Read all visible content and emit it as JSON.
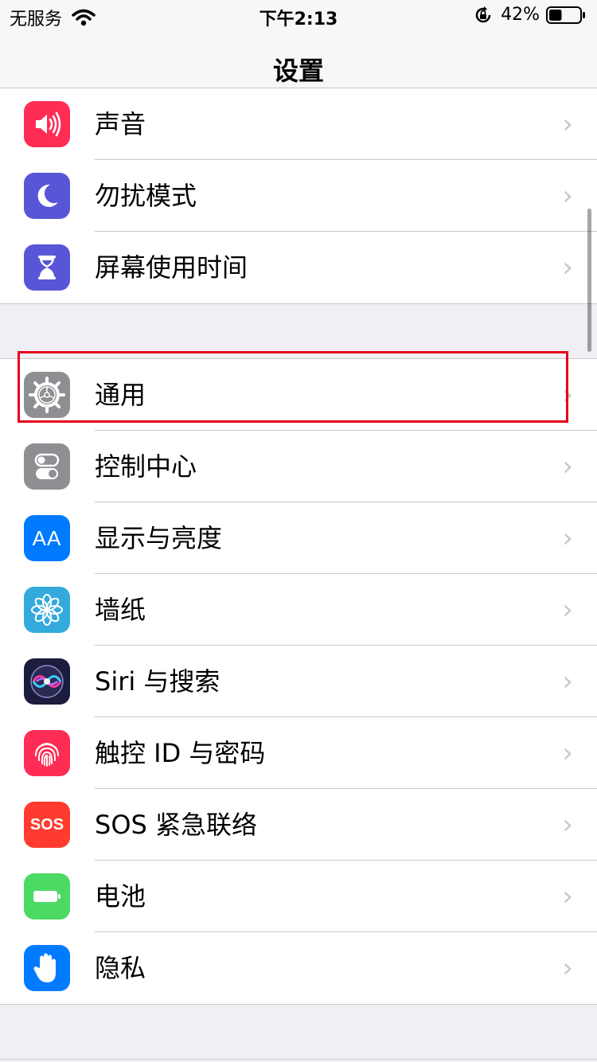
{
  "status_bar": {
    "carrier": "无服务",
    "wifi_icon": "wifi-icon",
    "time": "下午2:13",
    "orientation_lock_icon": "orientation-lock-icon",
    "battery_percent": "42%",
    "battery_level": 0.42
  },
  "nav": {
    "title": "设置"
  },
  "groups": [
    {
      "items": [
        {
          "label": "声音",
          "icon": "speaker-icon",
          "color": "#ff2d55"
        },
        {
          "label": "勿扰模式",
          "icon": "moon-icon",
          "color": "#5856d6"
        },
        {
          "label": "屏幕使用时间",
          "icon": "hourglass-icon",
          "color": "#5856d6"
        }
      ]
    },
    {
      "items": [
        {
          "label": "通用",
          "icon": "gear-icon",
          "color": "#8e8e93"
        },
        {
          "label": "控制中心",
          "icon": "toggles-icon",
          "color": "#8e8e93"
        },
        {
          "label": "显示与亮度",
          "icon": "text-size-icon",
          "color": "#007aff",
          "icon_text": "AA"
        },
        {
          "label": "墙纸",
          "icon": "flower-icon",
          "color": "#34aadc"
        },
        {
          "label": "Siri 与搜索",
          "icon": "siri-icon",
          "color": "#1c1c3c"
        },
        {
          "label": "触控 ID 与密码",
          "icon": "fingerprint-icon",
          "color": "#ff2d55"
        },
        {
          "label": "SOS 紧急联络",
          "icon": "sos-icon",
          "color": "#ff3b30",
          "icon_text": "SOS"
        },
        {
          "label": "电池",
          "icon": "battery-icon",
          "color": "#4cd964"
        },
        {
          "label": "隐私",
          "icon": "hand-icon",
          "color": "#007aff"
        }
      ]
    }
  ],
  "highlight_color": "#e5001c"
}
